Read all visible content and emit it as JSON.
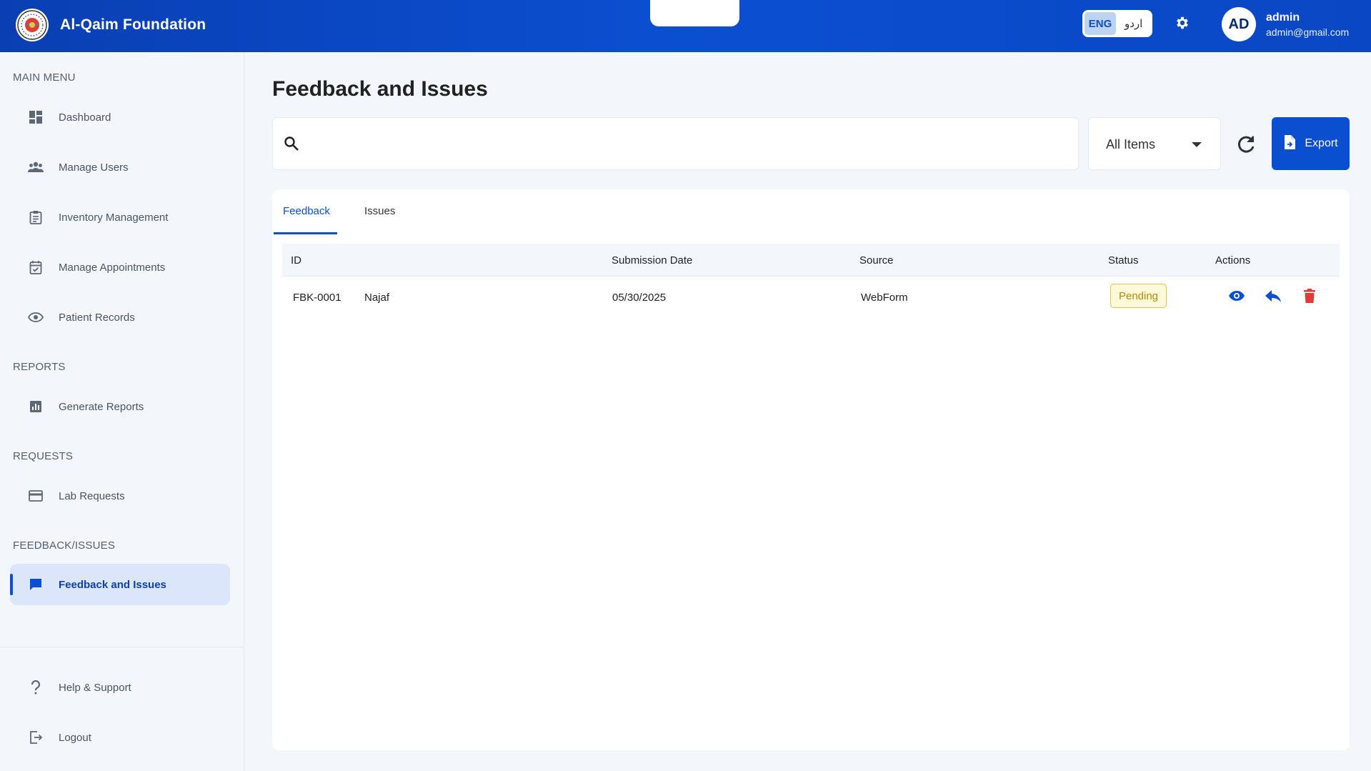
{
  "header": {
    "brand_name": "Al-Qaim Foundation",
    "lang_eng": "ENG",
    "lang_urdu": "اردو",
    "avatar_initials": "AD",
    "user_name": "admin",
    "user_email": "admin@gmail.com",
    "brand_color": "#0b4fd1"
  },
  "sidebar": {
    "sections": {
      "main_menu": "MAIN MENU",
      "reports": "REPORTS",
      "requests": "REQUESTS",
      "feedback_issues": "FEEDBACK/ISSUES"
    },
    "items": [
      {
        "label": "Dashboard",
        "icon": "dashboard-icon"
      },
      {
        "label": "Manage Users",
        "icon": "users-icon"
      },
      {
        "label": "Inventory Management",
        "icon": "clipboard-icon"
      },
      {
        "label": "Manage Appointments",
        "icon": "calendar-check-icon"
      },
      {
        "label": "Patient Records",
        "icon": "eye-icon"
      },
      {
        "label": "Generate Reports",
        "icon": "bar-chart-icon"
      },
      {
        "label": "Lab Requests",
        "icon": "card-icon"
      },
      {
        "label": "Feedback and Issues",
        "icon": "chat-icon",
        "active": true
      },
      {
        "label": "Help & Support",
        "icon": "question-icon"
      },
      {
        "label": "Logout",
        "icon": "logout-icon"
      }
    ]
  },
  "main": {
    "title": "Feedback and Issues",
    "search": {
      "value": "",
      "placeholder": ""
    },
    "filter": {
      "selected": "All Items"
    },
    "export_label": "Export",
    "tabs": [
      {
        "label": "Feedback",
        "active": true
      },
      {
        "label": "Issues",
        "active": false
      }
    ],
    "table": {
      "columns": [
        "ID",
        "Submission Date",
        "Source",
        "Status",
        "Actions"
      ],
      "rows": [
        {
          "id": "FBK-0001",
          "name": "Najaf",
          "date": "05/30/2025",
          "source": "WebForm",
          "status": "Pending"
        }
      ]
    },
    "status_colors": {
      "pending_bg": "#fff8d9",
      "pending_text": "#b38a00",
      "delete": "#e53935"
    }
  }
}
